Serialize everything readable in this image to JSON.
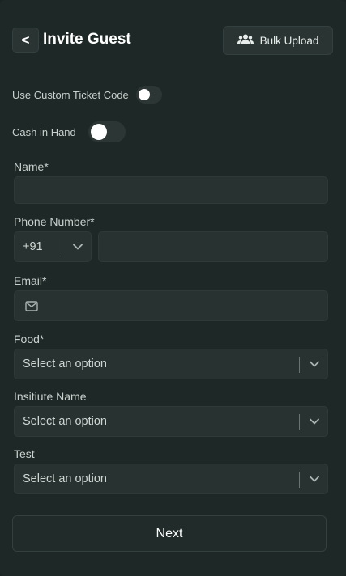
{
  "header": {
    "back_label": "<",
    "title": "Invite Guest",
    "bulk_upload_label": "Bulk Upload",
    "bulk_upload_icon": "users-icon"
  },
  "toggles": {
    "custom_ticket_code": {
      "label": "Use Custom Ticket Code",
      "on": false
    },
    "cash_in_hand": {
      "label": "Cash in Hand",
      "on": false
    }
  },
  "form": {
    "name": {
      "label": "Name*",
      "value": ""
    },
    "phone": {
      "label": "Phone Number*",
      "country_code": "+91",
      "value": ""
    },
    "email": {
      "label": "Email*",
      "value": "",
      "icon": "mail-icon"
    },
    "food": {
      "label": "Food*",
      "placeholder": "Select an option"
    },
    "institute": {
      "label": "Insitiute Name",
      "placeholder": "Select an option"
    },
    "test": {
      "label": "Test",
      "placeholder": "Select an option"
    }
  },
  "actions": {
    "next_label": "Next"
  },
  "colors": {
    "background": "#1e2826",
    "field": "#283230",
    "text": "#c9d0ce"
  }
}
